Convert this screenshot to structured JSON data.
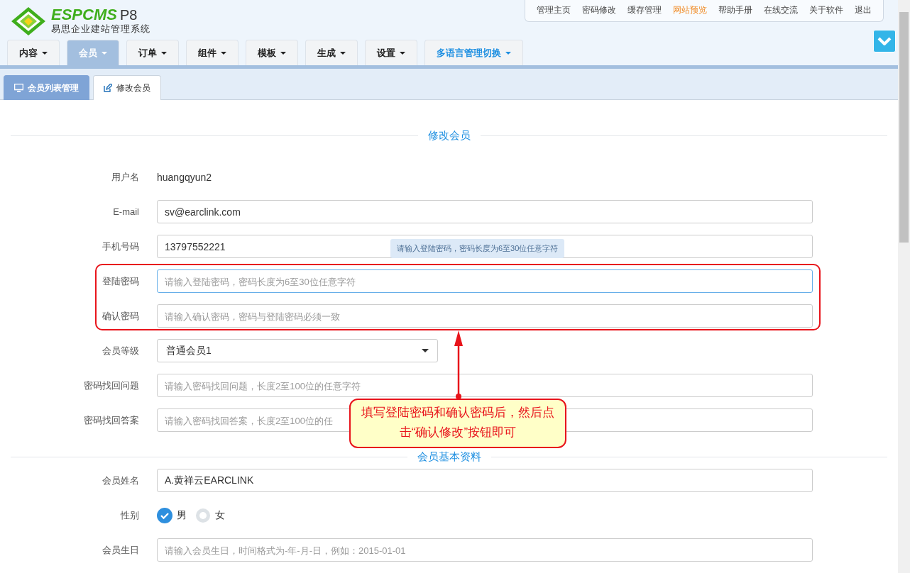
{
  "logo": {
    "brand": "ESPCMS",
    "version": "P8",
    "subtitle": "易思企业建站管理系统"
  },
  "top_links": [
    {
      "label": "管理主页",
      "highlight": false
    },
    {
      "label": "密码修改",
      "highlight": false
    },
    {
      "label": "缓存管理",
      "highlight": false
    },
    {
      "label": "网站预览",
      "highlight": true
    },
    {
      "label": "帮助手册",
      "highlight": false
    },
    {
      "label": "在线交流",
      "highlight": false
    },
    {
      "label": "关于软件",
      "highlight": false
    },
    {
      "label": "退出",
      "highlight": false
    }
  ],
  "nav_tabs": [
    {
      "label": "内容",
      "selected": false,
      "accent": false
    },
    {
      "label": "会员",
      "selected": true,
      "accent": false
    },
    {
      "label": "订单",
      "selected": false,
      "accent": false
    },
    {
      "label": "组件",
      "selected": false,
      "accent": false
    },
    {
      "label": "模板",
      "selected": false,
      "accent": false
    },
    {
      "label": "生成",
      "selected": false,
      "accent": false
    },
    {
      "label": "设置",
      "selected": false,
      "accent": false
    },
    {
      "label": "多语言管理切换",
      "selected": false,
      "accent": true
    }
  ],
  "sub_tabs": [
    {
      "label": "会员列表管理",
      "kind": "monitor",
      "selected": false
    },
    {
      "label": "修改会员",
      "kind": "edit",
      "selected": true
    }
  ],
  "section_1": {
    "title": "修改会员",
    "fields": [
      {
        "kind": "static",
        "label": "用户名",
        "value": "huangqyun2"
      },
      {
        "kind": "input",
        "label": "E-mail",
        "value": "sv@earclink.com"
      },
      {
        "kind": "input",
        "label": "手机号码",
        "value": "13797552221"
      },
      {
        "kind": "input",
        "label": "登陆密码",
        "placeholder": "请输入登陆密码，密码长度为6至30位任意字符",
        "focused": true,
        "tooltip": "请输入登陆密码，密码长度为6至30位任意字符"
      },
      {
        "kind": "input",
        "label": "确认密码",
        "placeholder": "请输入确认密码，密码与登陆密码必须一致"
      },
      {
        "kind": "select",
        "label": "会员等级",
        "value": "普通会员1"
      },
      {
        "kind": "input",
        "label": "密码找回问题",
        "placeholder": "请输入密码找回问题，长度2至100位的任意字符"
      },
      {
        "kind": "input",
        "label": "密码找回答案",
        "placeholder": "请输入密码找回答案，长度2至100位的任"
      }
    ]
  },
  "section_2": {
    "title": "会员基本资料",
    "fields": [
      {
        "kind": "input",
        "label": "会员姓名",
        "value": "A.黄祥云EARCLINK"
      },
      {
        "kind": "radio",
        "label": "性别",
        "options": [
          {
            "label": "男",
            "selected": true
          },
          {
            "label": "女",
            "selected": false
          }
        ]
      },
      {
        "kind": "input",
        "label": "会员生日",
        "placeholder": "请输入会员生日，时间格式为-年-月-日，例如：2015-01-01"
      }
    ]
  },
  "annotation": {
    "text": "填写登陆密码和确认密码后，然后点击“确认修改”按钮即可"
  }
}
